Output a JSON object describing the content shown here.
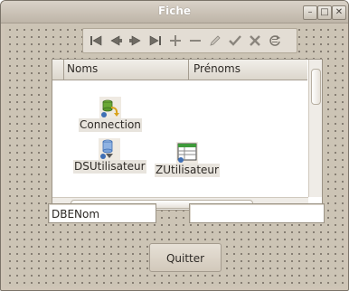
{
  "window": {
    "title": "Fiche",
    "controls": [
      "minimize-icon",
      "maximize-icon",
      "close-icon"
    ]
  },
  "navigator": {
    "buttons": [
      {
        "name": "first-record-icon"
      },
      {
        "name": "prior-record-icon"
      },
      {
        "name": "next-record-icon"
      },
      {
        "name": "last-record-icon"
      },
      {
        "name": "insert-record-icon"
      },
      {
        "name": "delete-record-icon"
      },
      {
        "name": "edit-record-icon"
      },
      {
        "name": "post-record-icon"
      },
      {
        "name": "cancel-record-icon"
      },
      {
        "name": "refresh-record-icon"
      }
    ]
  },
  "grid": {
    "columns": [
      "Noms",
      "Prénoms"
    ]
  },
  "components": {
    "connection": "Connection",
    "datasource": "DSUtilisateur",
    "query": "ZUtilisateur"
  },
  "fields": {
    "nom_value": "DBENom",
    "prenom_value": ""
  },
  "buttons": {
    "quit_label": "Quitter"
  },
  "colors": {
    "form_background": "#ccc4b5",
    "grid_background": "#ffffff",
    "title_text": "#ffffff"
  }
}
